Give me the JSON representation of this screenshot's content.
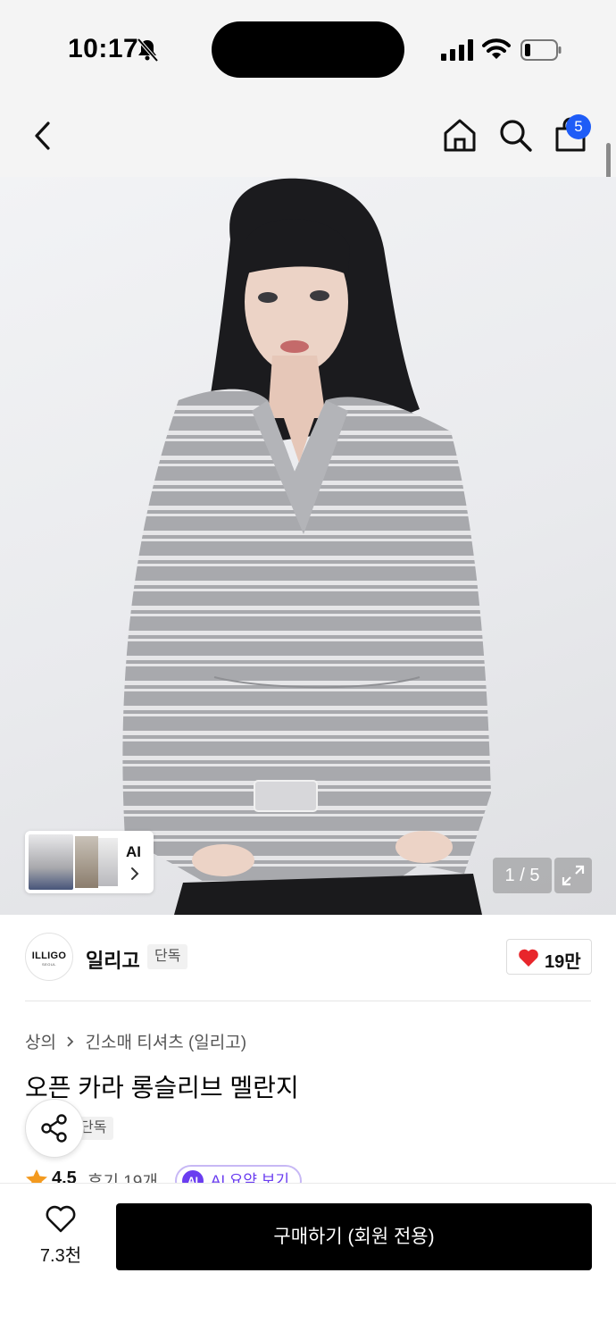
{
  "status_bar": {
    "time": "10:17",
    "icons": [
      "bell-muted-icon",
      "signal-icon",
      "wifi-icon",
      "battery-low-icon"
    ]
  },
  "nav": {
    "icons": [
      "back-icon",
      "home-icon",
      "search-icon",
      "shopping-bag-icon"
    ],
    "cart_count": "5"
  },
  "gallery": {
    "ai_label": "AI",
    "counter": "1 / 5",
    "expand_icon": "expand-icon"
  },
  "brand": {
    "logo_text": "ILLIGO",
    "logo_subtext": "SEOUL",
    "name": "일리고",
    "tag": "단독",
    "likes": "19만"
  },
  "product": {
    "breadcrumb": [
      "상의",
      "긴소매 티셔츠 (일리고)"
    ],
    "title": "오픈 카라 롱슬리브 멜란지",
    "tag": "단독",
    "rating": "4.5",
    "review_count": "후기 19개",
    "ai_summary_badge": "AI",
    "ai_summary_label": "AI 요약 보기"
  },
  "bottom_bar": {
    "wish_count": "7.3천",
    "buy_label": "구매하기 (회원 전용)"
  },
  "colors": {
    "accent": "#1e5cf7",
    "heart": "#e8262b",
    "ai_purple": "#6a3df0",
    "buy_button": "#000000",
    "star": "#f39a1f"
  }
}
